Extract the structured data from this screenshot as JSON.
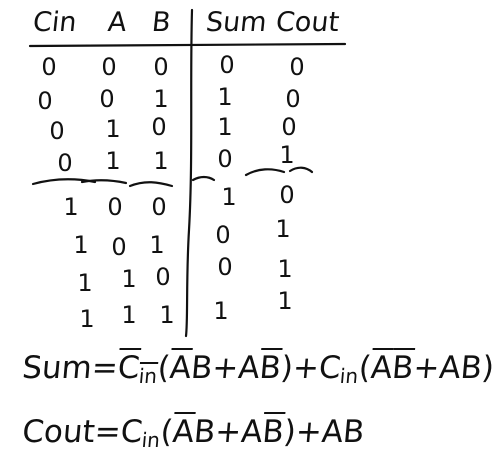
{
  "table": {
    "headers": [
      "Cin",
      "A",
      "B",
      "Sum",
      "Cout"
    ],
    "rows": [
      [
        "0",
        "0",
        "0",
        "0",
        "0"
      ],
      [
        "0",
        "0",
        "1",
        "1",
        "0"
      ],
      [
        "0",
        "1",
        "0",
        "1",
        "0"
      ],
      [
        "0",
        "1",
        "1",
        "0",
        "1"
      ],
      [
        "1",
        "0",
        "0",
        "1",
        "0"
      ],
      [
        "1",
        "0",
        "1",
        "0",
        "1"
      ],
      [
        "1",
        "1",
        "0",
        "0",
        "1"
      ],
      [
        "1",
        "1",
        "1",
        "1",
        "1"
      ]
    ]
  },
  "equations": {
    "sum": {
      "lhs": "Sum",
      "eq": "=",
      "cin": "C",
      "cin_sub": "in",
      "a": "A",
      "b": "B",
      "plus": "+",
      "open": "(",
      "close": ")"
    },
    "cout": {
      "lhs": "Cout",
      "eq": "=",
      "cin": "C",
      "cin_sub": "in",
      "a": "A",
      "b": "B",
      "plus": "+",
      "open": "(",
      "close": ")"
    }
  }
}
